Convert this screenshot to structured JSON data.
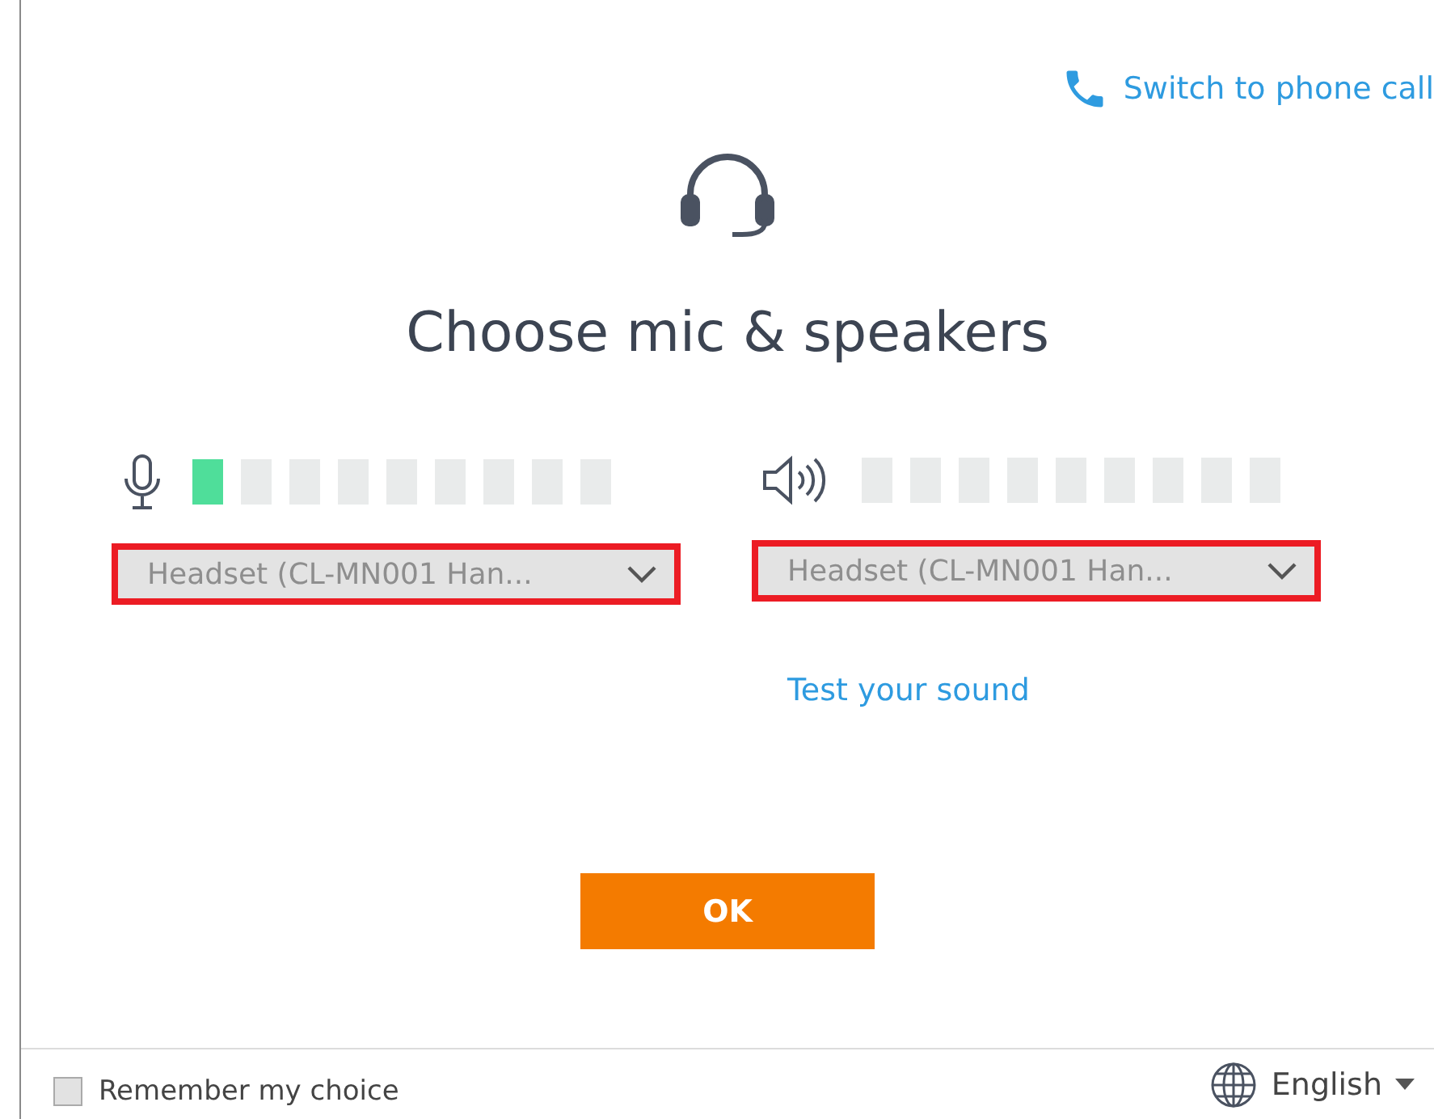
{
  "phone_link": "Switch to phone call",
  "title": "Choose mic & speakers",
  "devices": [
    {
      "kind": "mic",
      "level": 0.11,
      "dropdown": {
        "value": "Headset (CL-MN001 Han...",
        "highlighted": true
      }
    },
    {
      "kind": "speaker",
      "dropdown": {
        "value": "Headset (CL-MN001 Han...",
        "highlighted": true
      }
    }
  ],
  "test_link": "Test your sound",
  "ok_button": "OK",
  "remember": {
    "label": "Remember my choice",
    "checked": false
  },
  "language": "English"
}
